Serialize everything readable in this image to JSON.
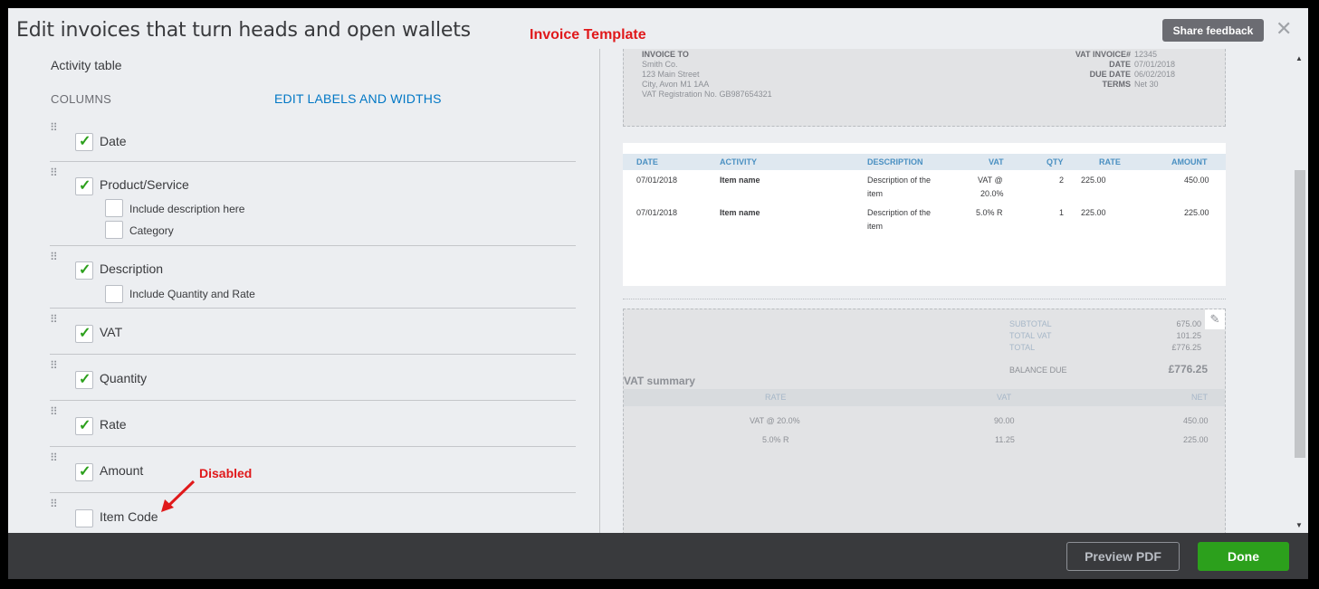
{
  "header": {
    "title": "Edit invoices that turn heads and open wallets",
    "annotation_invoice": "Invoice Template",
    "share_feedback": "Share feedback",
    "close": "✕"
  },
  "left": {
    "section_title": "Activity table",
    "columns_label": "COLUMNS",
    "edit_link": "EDIT LABELS AND WIDTHS",
    "rows": {
      "date": "Date",
      "product": "Product/Service",
      "include_description": "Include description here",
      "category": "Category",
      "description": "Description",
      "include_qty_rate": "Include Quantity and Rate",
      "vat": "VAT",
      "quantity": "Quantity",
      "rate": "Rate",
      "amount": "Amount",
      "item_code": "Item Code"
    },
    "annotation_disabled": "Disabled"
  },
  "preview": {
    "invoice_to_label": "INVOICE TO",
    "address": [
      "Smith Co.",
      "123 Main Street",
      "City, Avon M1 1AA",
      "VAT Registration No. GB987654321"
    ],
    "meta_labels": [
      "VAT INVOICE#",
      "DATE",
      "DUE DATE",
      "TERMS"
    ],
    "meta_values": [
      "12345",
      "07/01/2018",
      "06/02/2018",
      "Net 30"
    ],
    "table_headers": [
      "DATE",
      "ACTIVITY",
      "DESCRIPTION",
      "VAT",
      "QTY",
      "RATE",
      "AMOUNT"
    ],
    "rows": [
      {
        "date": "07/01/2018",
        "activity": "Item name",
        "desc1": "Description of the",
        "desc2": "item",
        "vat1": "VAT @",
        "vat2": "20.0%",
        "qty": "2",
        "rate": "225.00",
        "amount": "450.00"
      },
      {
        "date": "07/01/2018",
        "activity": "Item name",
        "desc1": "Description of the",
        "desc2": "item",
        "vat1": "5.0% R",
        "vat2": "",
        "qty": "1",
        "rate": "225.00",
        "amount": "225.00"
      }
    ],
    "totals_labels": [
      "SUBTOTAL",
      "TOTAL VAT",
      "TOTAL"
    ],
    "totals_values": [
      "675.00",
      "101.25",
      "£776.25"
    ],
    "balance_label": "BALANCE DUE",
    "balance_value": "£776.25",
    "vat_summary_title": "VAT summary",
    "vat_headers": [
      "RATE",
      "VAT",
      "NET"
    ],
    "vat_rows": [
      {
        "rate": "VAT @ 20.0%",
        "vat": "90.00",
        "net": "450.00"
      },
      {
        "rate": "5.0% R",
        "vat": "11.25",
        "net": "225.00"
      }
    ]
  },
  "footer": {
    "preview_pdf": "Preview PDF",
    "done": "Done"
  }
}
